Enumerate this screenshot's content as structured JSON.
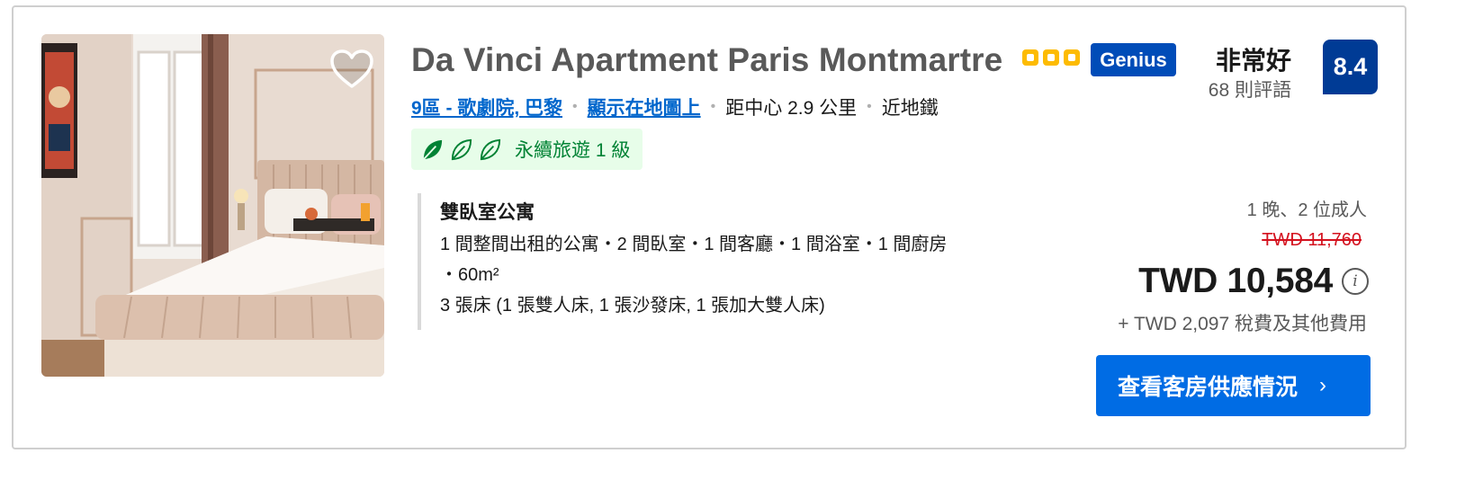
{
  "listing": {
    "title": "Da Vinci Apartment Paris Montmartre",
    "stars": 3,
    "badge": "Genius",
    "rating_word": "非常好",
    "review_count": "68 則評語",
    "score": "8.4",
    "location": {
      "area_link": "9區 - 歌劇院, 巴黎",
      "map_link": "顯示在地圖上",
      "distance": "距中心 2.9 公里",
      "transit": "近地鐵"
    },
    "sustainability": {
      "label": "永續旅遊 1 級",
      "leaves_filled": 1,
      "leaves_total": 3
    },
    "room": {
      "title": "雙臥室公寓",
      "line1": "1 間整間出租的公寓・2 間臥室・1 間客廳・1 間浴室・1 間廚房",
      "line2": "・60m²",
      "line3": "3 張床 (1 張雙人床, 1 張沙發床, 1 張加大雙人床)"
    },
    "pricing": {
      "stay": "1 晚、2 位成人",
      "original_price": "TWD 11,760",
      "price": "TWD 10,584",
      "taxes": "+ TWD 2,097 稅費及其他費用"
    },
    "cta": {
      "label": "查看客房供應情況",
      "chevron": "›"
    }
  },
  "icons": {
    "favorite": "heart-outline-icon",
    "info": "info-circle-icon",
    "sustainability": "leaf-icon"
  },
  "colors": {
    "link": "#0066cc",
    "score_bg": "#003b95",
    "genius_bg": "#004cb8",
    "cta_bg": "#006ce4",
    "sustain_bg": "#e7fde9",
    "sustain_text": "#008234",
    "strike_price": "#d4111e",
    "stars": "#fdbb02"
  }
}
